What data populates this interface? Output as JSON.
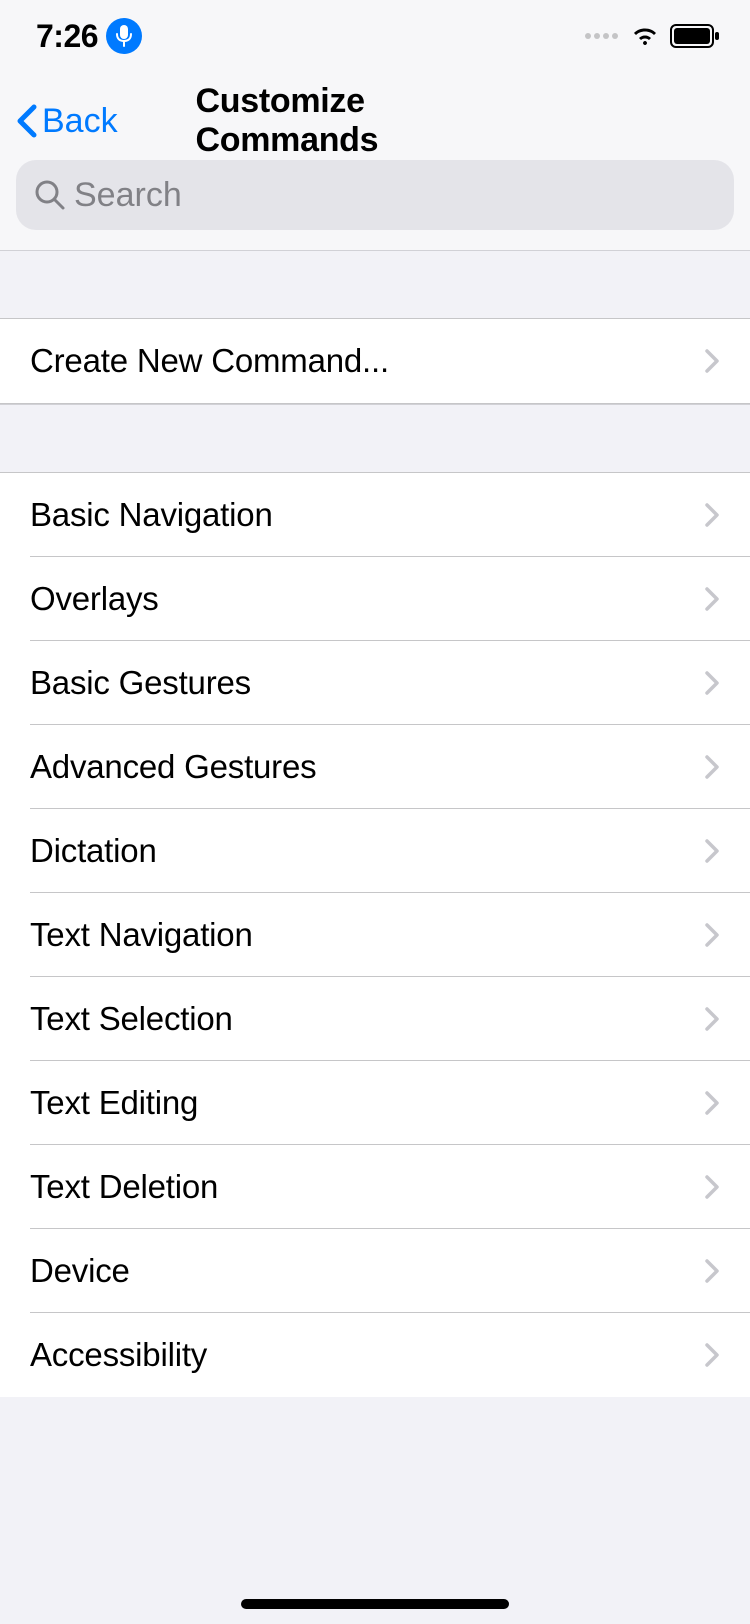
{
  "statusBar": {
    "time": "7:26"
  },
  "nav": {
    "backLabel": "Back",
    "title": "Customize Commands"
  },
  "search": {
    "placeholder": "Search"
  },
  "createSection": {
    "item": "Create New Command..."
  },
  "categories": [
    "Basic Navigation",
    "Overlays",
    "Basic Gestures",
    "Advanced Gestures",
    "Dictation",
    "Text Navigation",
    "Text Selection",
    "Text Editing",
    "Text Deletion",
    "Device",
    "Accessibility"
  ]
}
